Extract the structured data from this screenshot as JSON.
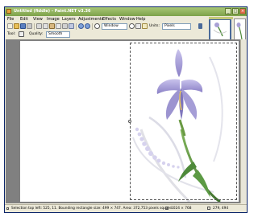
{
  "window": {
    "title": "Untitled (fiddle) - Paint.NET v3.36"
  },
  "menu": [
    "File",
    "Edit",
    "View",
    "Image",
    "Layers",
    "Adjustments",
    "Effects",
    "Window",
    "Help"
  ],
  "toolbar": {
    "zoom_value": "Window",
    "units_label": "Units:",
    "units_value": "Pixels"
  },
  "tool_options": {
    "tool_label": "Tool:",
    "quality_label": "Quality:",
    "quality_value": "Smooth"
  },
  "status": {
    "selection_info": "Selection top left: 525, 11. Bounding rectangle size: 499 × 747. Area: 372,753 pixels square",
    "image_size": "1024 × 768",
    "cursor_position": "279, 494"
  },
  "colors": {
    "title_bar": "#8fb35c",
    "canvas_background": "#808080",
    "iris_petal": "#a9a1d6",
    "stem": "#4e8a3a"
  }
}
